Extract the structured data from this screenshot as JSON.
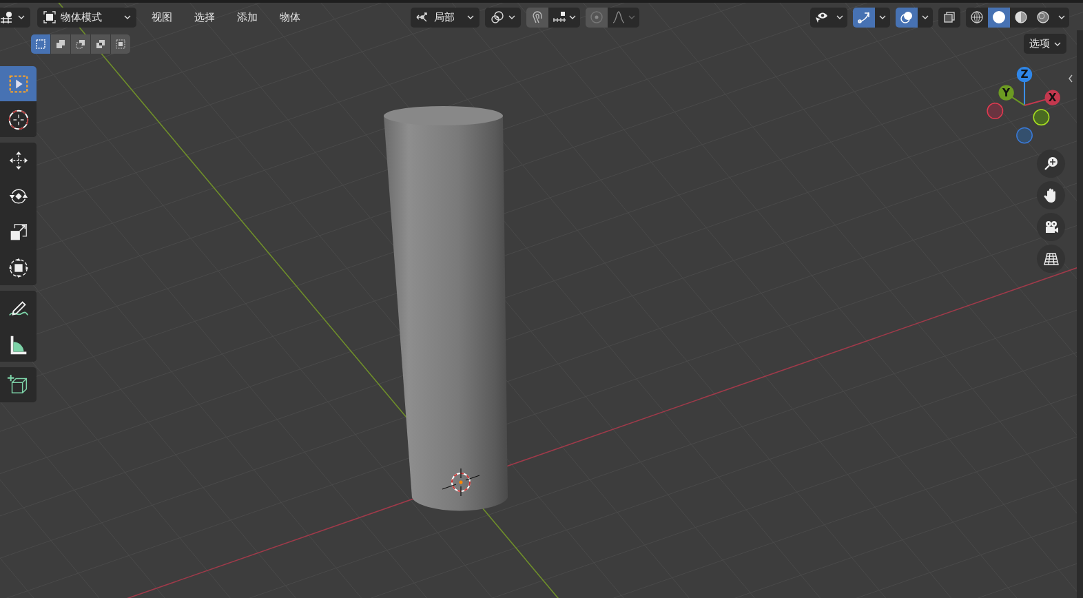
{
  "header": {
    "mode": "物体模式",
    "menus": [
      "视图",
      "选择",
      "添加",
      "物体"
    ],
    "orientation": "局部"
  },
  "select_modes": [
    {
      "kind": "new",
      "selected": true
    },
    {
      "kind": "extend",
      "selected": false
    },
    {
      "kind": "subtract",
      "selected": false
    },
    {
      "kind": "invert",
      "selected": false
    },
    {
      "kind": "intersect",
      "selected": false
    }
  ],
  "display_toggles": [
    {
      "kind": "visibility",
      "selected": false
    },
    {
      "kind": "gizmos",
      "selected": true
    },
    {
      "kind": "overlays",
      "selected": true
    },
    {
      "kind": "xray",
      "selected": false
    }
  ],
  "shading_modes": [
    {
      "kind": "wireframe",
      "selected": false
    },
    {
      "kind": "solid",
      "selected": true
    },
    {
      "kind": "material",
      "selected": false
    },
    {
      "kind": "rendered",
      "selected": false
    }
  ],
  "options": "选项",
  "tools": [
    {
      "items": [
        {
          "kind": "select",
          "selected": true
        },
        {
          "kind": "cursor",
          "selected": false
        }
      ]
    },
    {
      "items": [
        {
          "kind": "move",
          "selected": false
        },
        {
          "kind": "rotate",
          "selected": false
        },
        {
          "kind": "scale",
          "selected": false
        },
        {
          "kind": "transform",
          "selected": false
        }
      ]
    },
    {
      "items": [
        {
          "kind": "annotate",
          "selected": false
        },
        {
          "kind": "measure",
          "selected": false
        }
      ]
    },
    {
      "items": [
        {
          "kind": "add-cube",
          "selected": false
        }
      ]
    }
  ],
  "gizmo": {
    "z": "Z",
    "y": "Y",
    "x": "X"
  }
}
